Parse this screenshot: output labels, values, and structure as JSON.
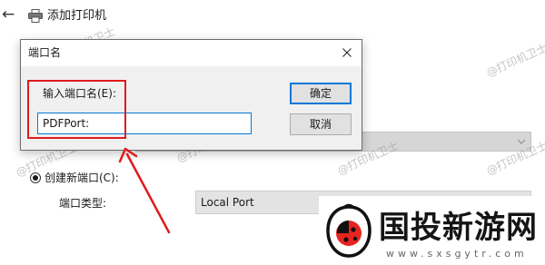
{
  "wizard": {
    "title": "添加打印机"
  },
  "background": {
    "create_port_label": "创建新端口(C):",
    "port_type_label": "端口类型:",
    "port_type_value": "Local Port"
  },
  "dialog": {
    "title": "端口名",
    "field_label": "输入端口名(E):",
    "port_name_value": "PDFPort:",
    "ok_label": "确定",
    "cancel_label": "取消"
  },
  "watermark": {
    "text": "@打印机卫士"
  },
  "logo": {
    "brand": "国投新游网",
    "url": "www.sxsgytr.com"
  },
  "colors": {
    "annotation": "#e01b1b",
    "focus_border": "#0078d7"
  },
  "icons": {
    "back": "back-arrow-icon",
    "printer": "printer-icon",
    "close": "close-icon",
    "dropdown": "chevron-down-icon"
  }
}
